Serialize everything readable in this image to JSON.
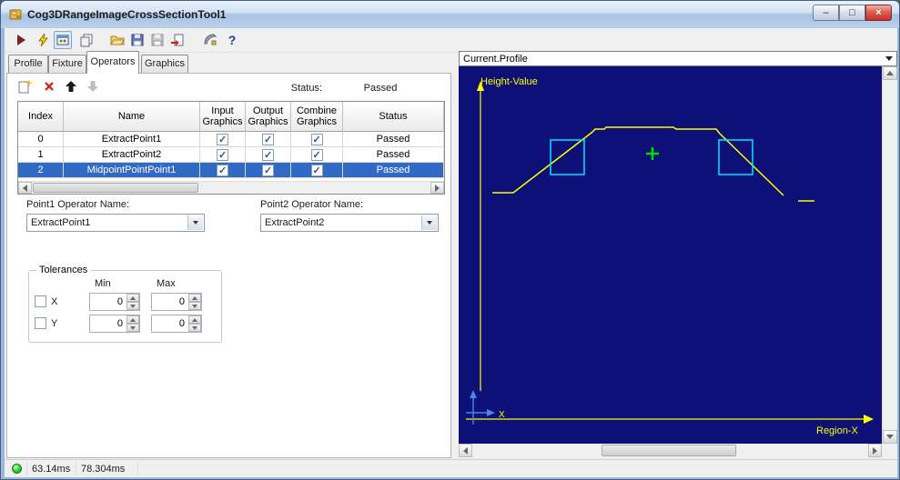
{
  "window": {
    "title": "Cog3DRangeImageCrossSectionTool1",
    "minimize_glyph": "–",
    "maximize_glyph": "□",
    "close_glyph": "×"
  },
  "toolbar": {
    "icons": [
      "run-icon",
      "trigger-icon",
      "record-display-icon",
      "new-window-icon",
      "open-icon",
      "save-icon",
      "save-as-icon",
      "import-icon",
      "measure-icon",
      "help-icon"
    ],
    "help_glyph": "?"
  },
  "tabs": [
    {
      "label": "Profile",
      "active": false
    },
    {
      "label": "Fixture",
      "active": false
    },
    {
      "label": "Operators",
      "active": true
    },
    {
      "label": "Graphics",
      "active": false
    }
  ],
  "operators": {
    "status_label": "Status:",
    "status_value": "Passed",
    "table": {
      "columns": [
        "Index",
        "Name",
        "Input Graphics",
        "Output Graphics",
        "Combine Graphics",
        "Status"
      ],
      "rows": [
        {
          "index": "0",
          "name": "ExtractPoint1",
          "input_graphics": true,
          "output_graphics": true,
          "combine_graphics": true,
          "status": "Passed",
          "selected": false
        },
        {
          "index": "1",
          "name": "ExtractPoint2",
          "input_graphics": true,
          "output_graphics": true,
          "combine_graphics": true,
          "status": "Passed",
          "selected": false
        },
        {
          "index": "2",
          "name": "MidpointPointPoint1",
          "input_graphics": true,
          "output_graphics": true,
          "combine_graphics": true,
          "status": "Passed",
          "selected": true
        }
      ]
    },
    "point1_label": "Point1 Operator Name:",
    "point1_value": "ExtractPoint1",
    "point2_label": "Point2 Operator Name:",
    "point2_value": "ExtractPoint2",
    "tolerances": {
      "title": "Tolerances",
      "min_header": "Min",
      "max_header": "Max",
      "rows": [
        {
          "label": "X",
          "enabled": false,
          "min": "0",
          "max": "0"
        },
        {
          "label": "Y",
          "enabled": false,
          "min": "0",
          "max": "0"
        }
      ]
    }
  },
  "display": {
    "selector_value": "Current.Profile",
    "chart": {
      "ylabel": "Height-Value",
      "xlabel": "Region-X",
      "origin_label": "X",
      "background": "#0d1076",
      "profile_color": "#ffff00",
      "axis_color": "#ffff00",
      "region_color": "#00e5ff",
      "marker_color": "#00dd00",
      "origin_axis_color": "#4a86e8"
    }
  },
  "statusbar": {
    "led_color": "#33cc33",
    "time1": "63.14ms",
    "time2": "78.304ms"
  }
}
